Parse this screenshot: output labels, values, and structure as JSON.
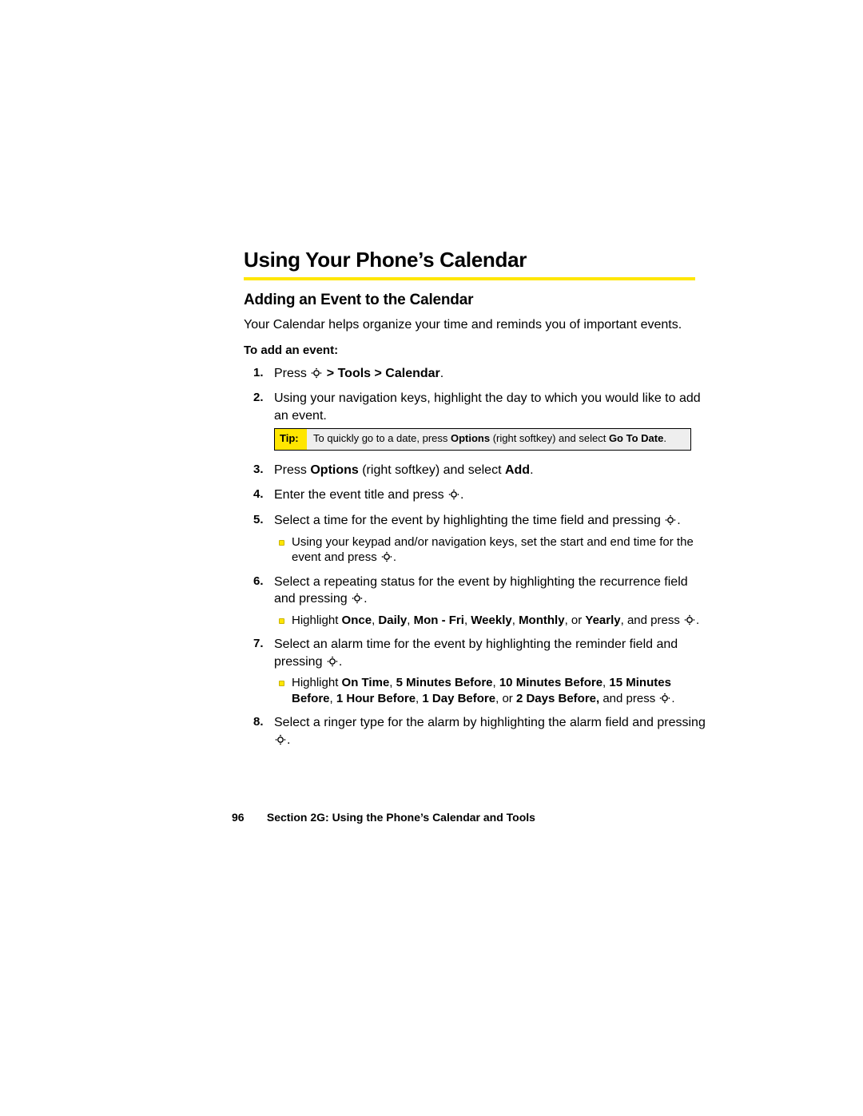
{
  "heading": "Using Your Phone’s Calendar",
  "subheading": "Adding an Event to the Calendar",
  "intro": "Your Calendar helps organize your time and reminds you of important events.",
  "lead": "To add an event:",
  "steps": {
    "s1": {
      "pre": "Press ",
      "bold": " > Tools > Calendar",
      "post": "."
    },
    "s2": "Using your navigation keys, highlight the day to which you would like to add an event.",
    "s3": {
      "a": "Press ",
      "b": "Options",
      "c": " (right softkey) and select ",
      "d": "Add",
      "e": "."
    },
    "s4": {
      "a": "Enter the event title and press ",
      "b": "."
    },
    "s5": {
      "a": "Select a time for the event by highlighting the time field and pressing ",
      "b": "."
    },
    "s5sub": {
      "a": "Using your keypad and/or navigation keys, set the start and end time for the event and press ",
      "b": "."
    },
    "s6": {
      "a": "Select a repeating status for the event by highlighting the recurrence field and pressing ",
      "b": "."
    },
    "s6sub": {
      "a": "Highlight ",
      "b1": "Once",
      "c1": ", ",
      "b2": "Daily",
      "c2": ", ",
      "b3": "Mon - Fri",
      "c3": ", ",
      "b4": "Weekly",
      "c4": ", ",
      "b5": "Monthly",
      "c5": ", or ",
      "b6": "Yearly",
      "c6": ", and press ",
      "d": "."
    },
    "s7": {
      "a": "Select an alarm time for the event by highlighting the reminder field and pressing ",
      "b": "."
    },
    "s7sub": {
      "a": "Highlight ",
      "b1": "On Time",
      "c1": ", ",
      "b2": "5 Minutes Before",
      "c2": ", ",
      "b3": "10 Minutes Before",
      "c3": ", ",
      "b4": "15 Minutes Before",
      "c4": ", ",
      "b5": "1 Hour Before",
      "c5": ", ",
      "b6": "1 Day Before",
      "c6": ", or ",
      "b7": "2 Days Before,",
      "c7": " and press ",
      "d": "."
    },
    "s8": {
      "a": "Select a ringer type for the alarm by highlighting the alarm field and pressing ",
      "b": "."
    }
  },
  "tip": {
    "label": "Tip:",
    "a": "To quickly go to a date, press ",
    "b": "Options",
    "c": " (right softkey) and select ",
    "d": "Go To Date",
    "e": "."
  },
  "footer": {
    "page": "96",
    "text": "Section 2G: Using the Phone’s Calendar and Tools"
  }
}
